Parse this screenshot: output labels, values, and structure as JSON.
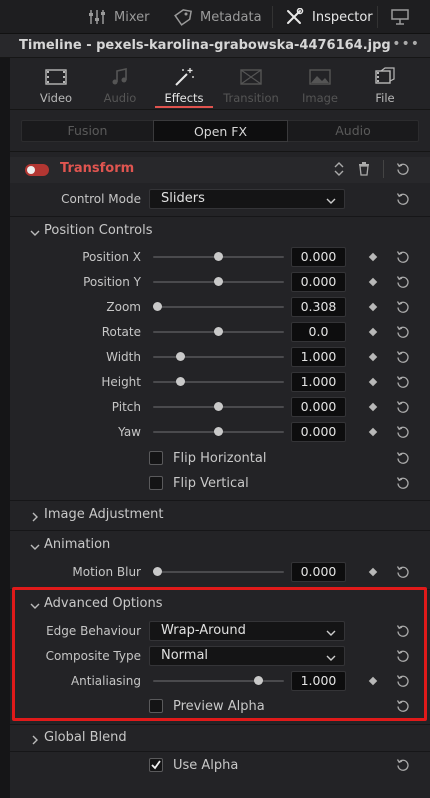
{
  "topbar": {
    "mixer": "Mixer",
    "metadata": "Metadata",
    "inspector": "Inspector"
  },
  "timeline": {
    "title": "Timeline - pexels-karolina-grabowska-4476164.jpg",
    "more": "•••"
  },
  "tabs": [
    {
      "label": "Video",
      "icon": "film-icon"
    },
    {
      "label": "Audio",
      "icon": "music-note-icon"
    },
    {
      "label": "Effects",
      "icon": "magic-wand-icon"
    },
    {
      "label": "Transition",
      "icon": "transition-icon"
    },
    {
      "label": "Image",
      "icon": "image-icon"
    },
    {
      "label": "File",
      "icon": "file-icon"
    }
  ],
  "segments": {
    "fusion": "Fusion",
    "openfx": "Open FX",
    "audio": "Audio"
  },
  "transform": {
    "title": "Transform",
    "enabled": true,
    "control_mode_label": "Control Mode",
    "control_mode_value": "Sliders"
  },
  "position_controls": {
    "title": "Position Controls",
    "rows": [
      {
        "label": "Position X",
        "value": "0.000",
        "slider": 0.5
      },
      {
        "label": "Position Y",
        "value": "0.000",
        "slider": 0.5
      },
      {
        "label": "Zoom",
        "value": "0.308",
        "slider": 0.0
      },
      {
        "label": "Rotate",
        "value": "0.0",
        "slider": 0.5
      },
      {
        "label": "Width",
        "value": "1.000",
        "slider": 0.19
      },
      {
        "label": "Height",
        "value": "1.000",
        "slider": 0.19
      },
      {
        "label": "Pitch",
        "value": "0.000",
        "slider": 0.5
      },
      {
        "label": "Yaw",
        "value": "0.000",
        "slider": 0.5
      }
    ],
    "flip_horizontal": "Flip Horizontal",
    "flip_vertical": "Flip Vertical"
  },
  "image_adjustment": {
    "title": "Image Adjustment"
  },
  "animation": {
    "title": "Animation",
    "motion_blur_label": "Motion Blur",
    "motion_blur_value": "0.000",
    "motion_blur_slider": 0.0
  },
  "advanced_options": {
    "title": "Advanced Options",
    "edge_behaviour_label": "Edge Behaviour",
    "edge_behaviour_value": "Wrap-Around",
    "composite_type_label": "Composite Type",
    "composite_type_value": "Normal",
    "antialiasing_label": "Antialiasing",
    "antialiasing_value": "1.000",
    "antialiasing_slider": 0.83,
    "preview_alpha": "Preview Alpha"
  },
  "global_blend": {
    "title": "Global Blend",
    "use_alpha": "Use Alpha",
    "use_alpha_checked": true
  },
  "colors": {
    "accent_red": "#e05550",
    "highlight_box": "#e01a1a",
    "toggle_on": "#b23632"
  }
}
